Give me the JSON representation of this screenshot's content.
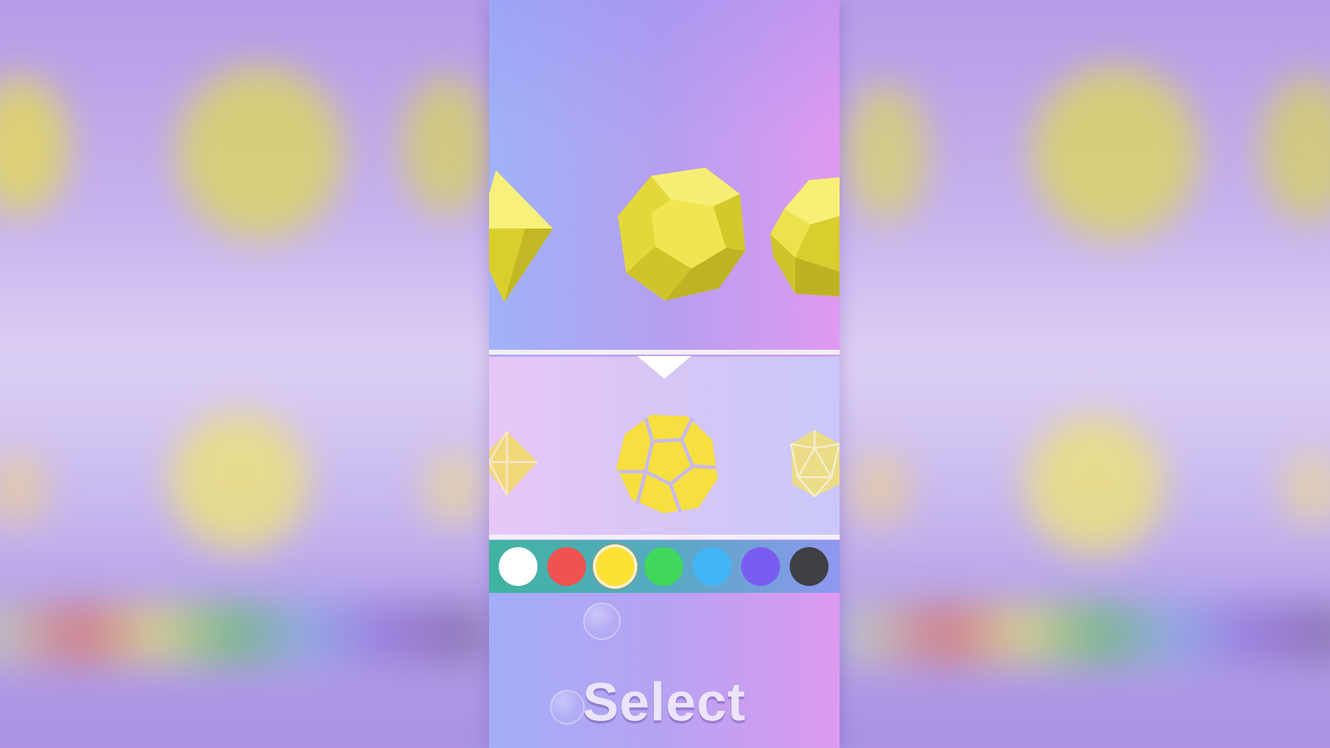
{
  "app": {
    "select_label": "Select"
  },
  "shapes_3d": [
    {
      "name": "octahedron",
      "color": "#f2e85a"
    },
    {
      "name": "dodecahedron",
      "color": "#f2e85a"
    },
    {
      "name": "icosahedron",
      "color": "#f2e85a"
    }
  ],
  "shape_icons": [
    {
      "name": "octahedron-icon"
    },
    {
      "name": "dodecahedron-icon",
      "selected": true
    },
    {
      "name": "icosahedron-icon"
    }
  ],
  "palette": {
    "colors": [
      "#ffffff",
      "#ef5350",
      "#fde135",
      "#3fd85a",
      "#43b4f5",
      "#7b5cf3",
      "#3f3f45"
    ],
    "selected_index": 2
  },
  "theme": {
    "shape_yellow": "#f2e85a",
    "divider": "#f4eefc"
  }
}
